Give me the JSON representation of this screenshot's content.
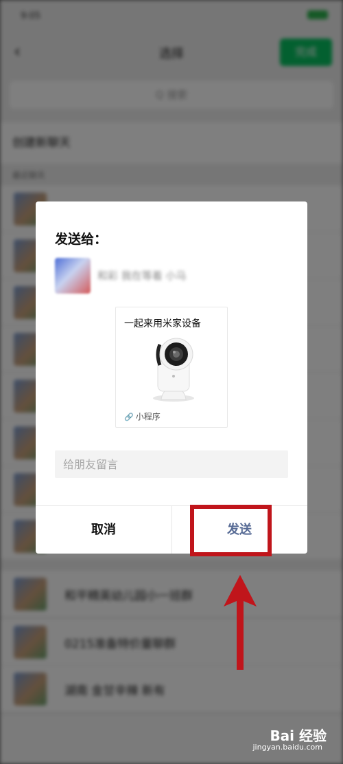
{
  "background": {
    "status_time": "9:05",
    "nav_back": "‹",
    "nav_title": "选择",
    "nav_action": "完成",
    "search_text": "Q 搜索",
    "section_title": "创建新聊天",
    "section_sub": "最近聊天",
    "rows": [
      {
        "name": ""
      },
      {
        "name": ""
      },
      {
        "name": ""
      },
      {
        "name": ""
      },
      {
        "name": ""
      },
      {
        "name": ""
      },
      {
        "name": ""
      },
      {
        "name": ""
      },
      {
        "name": "和平精英幼儿园小一班群"
      },
      {
        "name": "0215准备特价量聊群"
      },
      {
        "name": "湖南 金甘辛辣 新有"
      }
    ]
  },
  "dialog": {
    "title": "发送给：",
    "recipient_name": "和彩 我在等着 小马",
    "card": {
      "title": "一起来用米家设备",
      "image_icon": "security-camera-image",
      "footer_icon": "mini-program-link-icon",
      "footer_label": "小程序"
    },
    "message_placeholder": "给朋友留言",
    "cancel_label": "取消",
    "send_label": "发送"
  },
  "annotations": {
    "highlight_color": "#c0151b",
    "arrow_color": "#c0151b"
  },
  "watermark": {
    "brand": "Bai 经验",
    "url": "jingyan.baidu.com"
  },
  "colors": {
    "send_text": "#576b95",
    "wechat_green": "#07c160"
  }
}
